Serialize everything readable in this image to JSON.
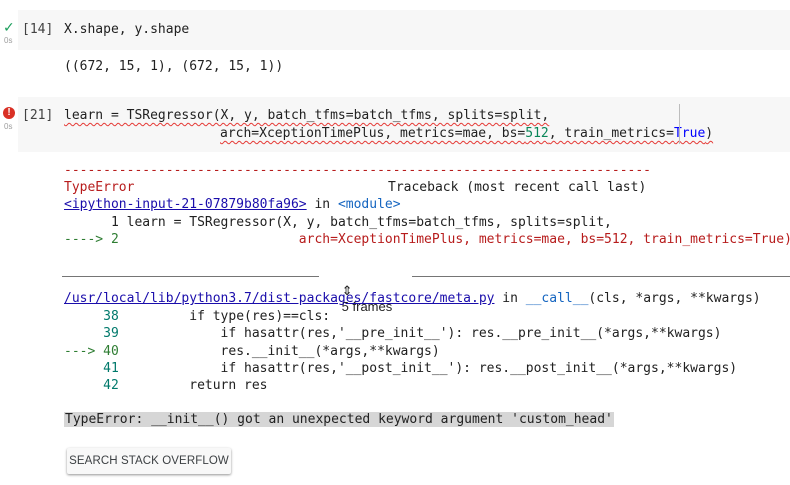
{
  "cell1": {
    "status_icon": "check-icon",
    "status_glyph": "✓",
    "runtime": "0s",
    "prompt": "[14]",
    "code": "X.shape, y.shape",
    "output": "((672, 15, 1), (672, 15, 1))"
  },
  "cell2": {
    "status_icon": "error-icon",
    "status_glyph": "!",
    "runtime": "0s",
    "prompt": "[21]",
    "code_line1": "learn = TSRegressor(X, y, batch_tfms=batch_tfms, splits=split,",
    "code_line2_pre": "arch=XceptionTimePlus, metrics=mae, bs=",
    "code_line2_num": "512",
    "code_line2_mid": ", train_metrics=",
    "code_line2_bool": "True",
    "code_line2_post": ")"
  },
  "traceback": {
    "dashes": "---------------------------------------------------------------------------",
    "error_type": "TypeError",
    "header_right": "Traceback (most recent call last)",
    "input_link": "<ipython-input-21-07879b80fa96>",
    "in_word": " in ",
    "module": "<module>",
    "line1_no": "      1",
    "line1_code": " learn = TSRegressor(X, y, batch_tfms=batch_tfms, splits=split,",
    "line2_arrow": "----> 2",
    "line2_code": "                       arch=XceptionTimePlus, metrics=mae, bs=512, train_metrics=True)",
    "frames_label": "5 frames",
    "frames_icon": "unfold-icon",
    "frames_glyph": "⇕",
    "file_link": "/usr/local/lib/python3.7/dist-packages/fastcore/meta.py",
    "file_in": " in ",
    "func": "__call__",
    "func_args": "(cls, *args, **kwargs)",
    "src_lines": [
      {
        "marker": "     38",
        "code": "         if type(res)==cls:"
      },
      {
        "marker": "     39",
        "code": "             if hasattr(res,'__pre_init__'): res.__pre_init__(*args,**kwargs)"
      },
      {
        "marker": "---> 40",
        "code": "             res.__init__(*args,**kwargs)"
      },
      {
        "marker": "     41",
        "code": "             if hasattr(res,'__post_init__'): res.__post_init__(*args,**kwargs)"
      },
      {
        "marker": "     42",
        "code": "         return res"
      }
    ],
    "final_error": "TypeError: __init__() got an unexpected keyword argument 'custom_head'"
  },
  "actions": {
    "search_button": "SEARCH STACK OVERFLOW"
  }
}
